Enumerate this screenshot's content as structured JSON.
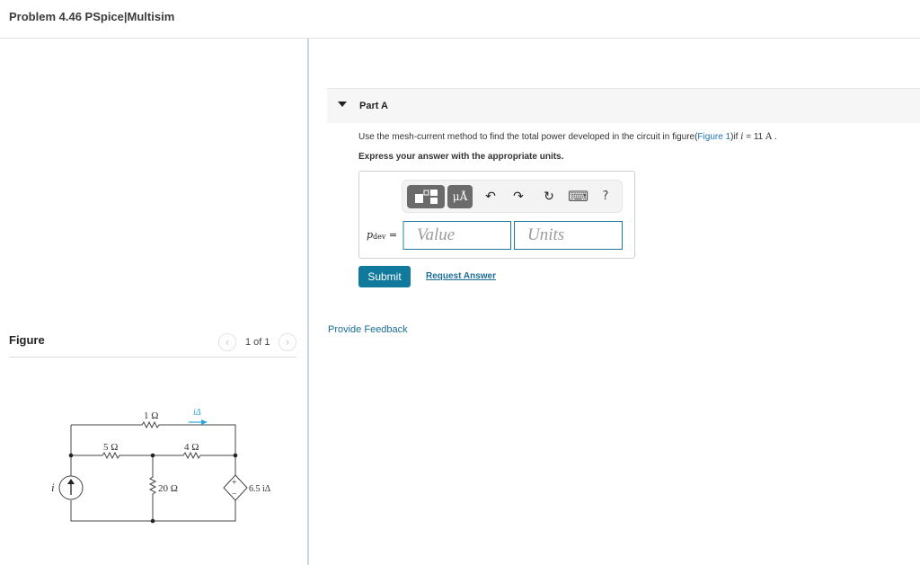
{
  "page": {
    "title": "Problem 4.46 PSpice|Multisim"
  },
  "figure_panel": {
    "heading": "Figure",
    "pager": {
      "prev_icon": "chevron-left-icon",
      "next_icon": "chevron-right-icon",
      "prev_glyph": "‹",
      "next_glyph": "›",
      "text": "1 of 1"
    },
    "circuit": {
      "resistors": {
        "r_top": "1 Ω",
        "r_left": "5 Ω",
        "r_right": "4 Ω",
        "r_middle": "20 Ω"
      },
      "current_source_label": "i",
      "control_current_label": "iΔ",
      "dependent_source_label": "6.5 iΔ",
      "dependent_source_coef": "6.5",
      "plus": "+",
      "minus": "−",
      "arrow_color": "#2aa7d9"
    }
  },
  "part_a": {
    "caret_icon": "caret-down-icon",
    "title": "Part A",
    "question": {
      "prefix": "Use the mesh-current method to find the total power developed in the circuit in figure(",
      "link": "Figure 1",
      "suffix": ")if ",
      "var": "i",
      "equals": " = 11 ",
      "unit": "A",
      "end": " ."
    },
    "instruction": "Express your answer with the appropriate units.",
    "toolbar": {
      "templates_icon": "templates-icon",
      "units_label": "μÅ",
      "undo_glyph": "↶",
      "redo_glyph": "↷",
      "reset_glyph": "↻",
      "keyboard_glyph": "⌨",
      "help_glyph": "?"
    },
    "answer": {
      "var": "p",
      "sub": "dev",
      "equals": " =",
      "value_placeholder": "Value",
      "units_placeholder": "Units"
    },
    "submit_label": "Submit",
    "request_answer_label": "Request Answer"
  },
  "feedback_label": "Provide Feedback",
  "colors": {
    "accent": "#117a9c",
    "link": "#1b6d96",
    "divider": "#c9d6e3"
  }
}
